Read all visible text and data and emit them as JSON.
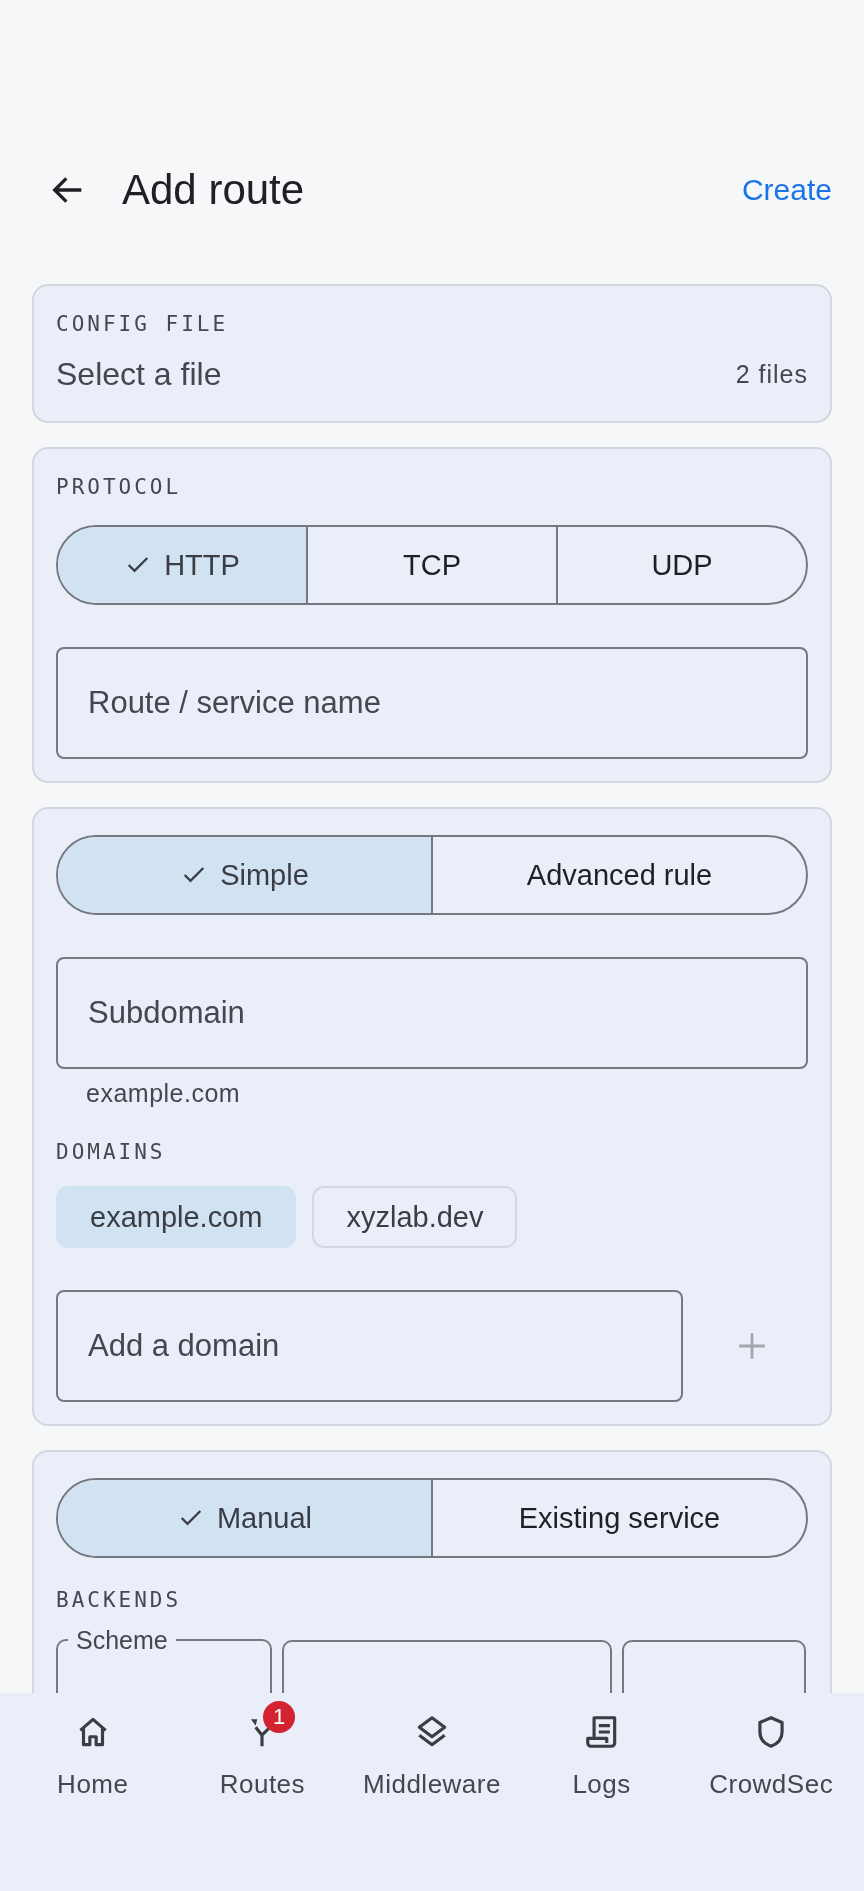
{
  "header": {
    "title": "Add route",
    "action": "Create"
  },
  "config_file": {
    "label": "CONFIG FILE",
    "placeholder": "Select a file",
    "count": "2 files"
  },
  "protocol": {
    "label": "PROTOCOL",
    "segments": [
      {
        "label": "HTTP",
        "selected": true
      },
      {
        "label": "TCP",
        "selected": false
      },
      {
        "label": "UDP",
        "selected": false
      }
    ],
    "name_field": {
      "placeholder": "Route / service name"
    }
  },
  "rule": {
    "segments": [
      {
        "label": "Simple",
        "selected": true
      },
      {
        "label": "Advanced rule",
        "selected": false
      }
    ],
    "subdomain_field": {
      "placeholder": "Subdomain"
    },
    "helper": "example.com",
    "domains_label": "DOMAINS",
    "domains": [
      {
        "label": "example.com",
        "selected": true
      },
      {
        "label": "xyzlab.dev",
        "selected": false
      }
    ],
    "add_domain_field": {
      "placeholder": "Add a domain"
    }
  },
  "service": {
    "segments": [
      {
        "label": "Manual",
        "selected": true
      },
      {
        "label": "Existing service",
        "selected": false
      }
    ],
    "backends_label": "BACKENDS",
    "scheme_label": "Scheme"
  },
  "nav": [
    {
      "kind": "home",
      "label": "Home"
    },
    {
      "kind": "routes",
      "label": "Routes",
      "badge": "1"
    },
    {
      "kind": "layers",
      "label": "Middleware"
    },
    {
      "kind": "logs",
      "label": "Logs"
    },
    {
      "kind": "shield",
      "label": "CrowdSec"
    }
  ]
}
